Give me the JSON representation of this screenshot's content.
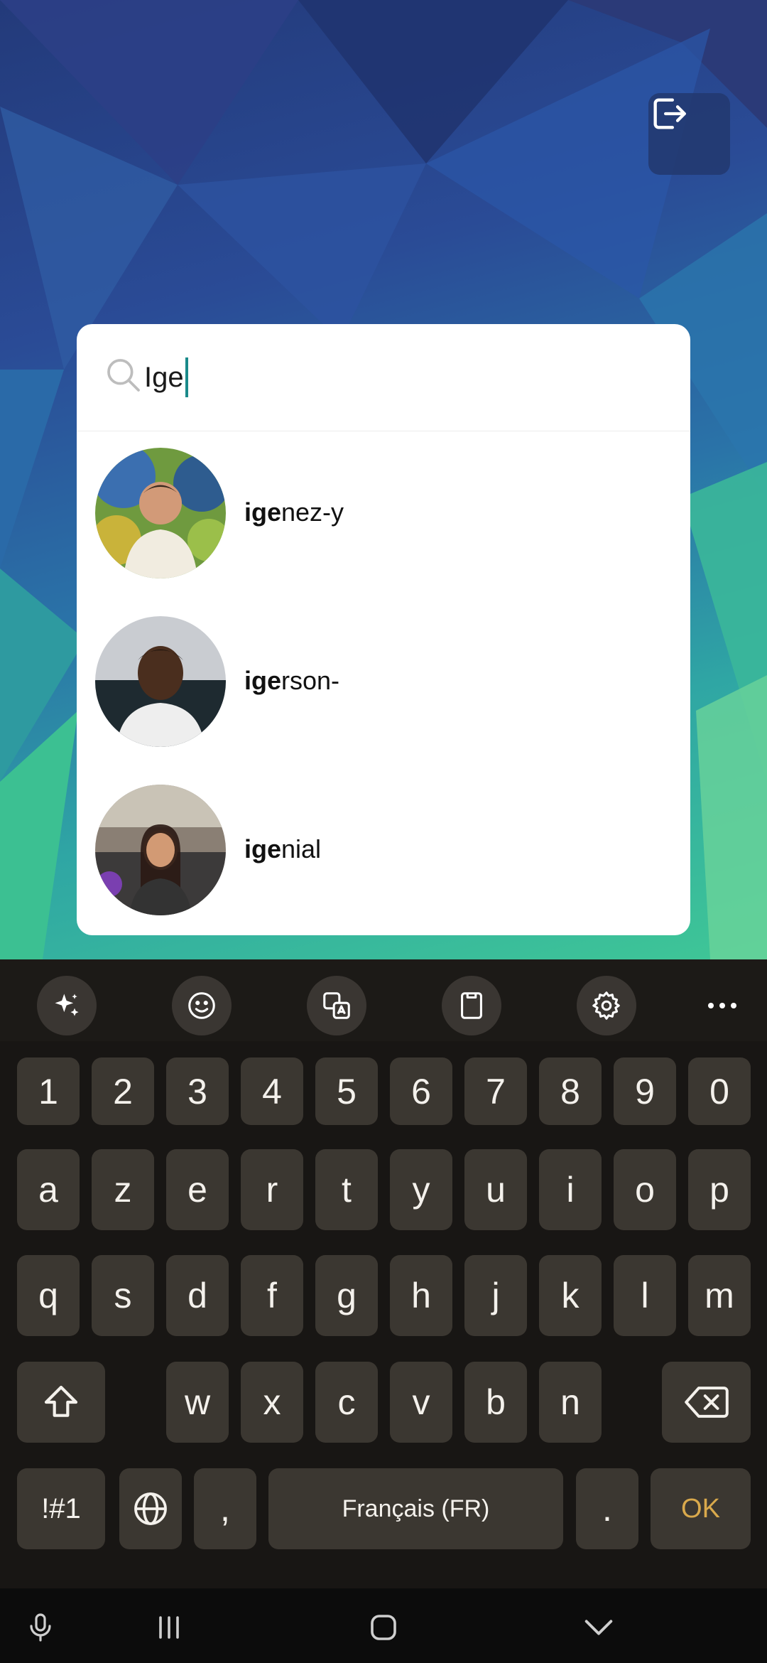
{
  "search": {
    "query": "Ige"
  },
  "results": [
    {
      "match": "ige",
      "rest": "nez-y"
    },
    {
      "match": "ige",
      "rest": "rson-"
    },
    {
      "match": "ige",
      "rest": "nial"
    }
  ],
  "keyboard": {
    "toolbar": [
      "sparkle-ai-icon",
      "emoji-icon",
      "translate-icon",
      "clipboard-icon",
      "settings-icon",
      "more-icon"
    ],
    "numbers": [
      "1",
      "2",
      "3",
      "4",
      "5",
      "6",
      "7",
      "8",
      "9",
      "0"
    ],
    "row1": [
      "a",
      "z",
      "e",
      "r",
      "t",
      "y",
      "u",
      "i",
      "o",
      "p"
    ],
    "row2": [
      "q",
      "s",
      "d",
      "f",
      "g",
      "h",
      "j",
      "k",
      "l",
      "m"
    ],
    "row3": [
      "w",
      "x",
      "c",
      "v",
      "b",
      "n"
    ],
    "symbols_label": "!#1",
    "comma": ",",
    "space_label": "Français (FR)",
    "period": ".",
    "ok_label": "OK"
  },
  "colors": {
    "accent": "#1a8a8a",
    "ok": "#d9a94c",
    "key": "#3b3731"
  }
}
